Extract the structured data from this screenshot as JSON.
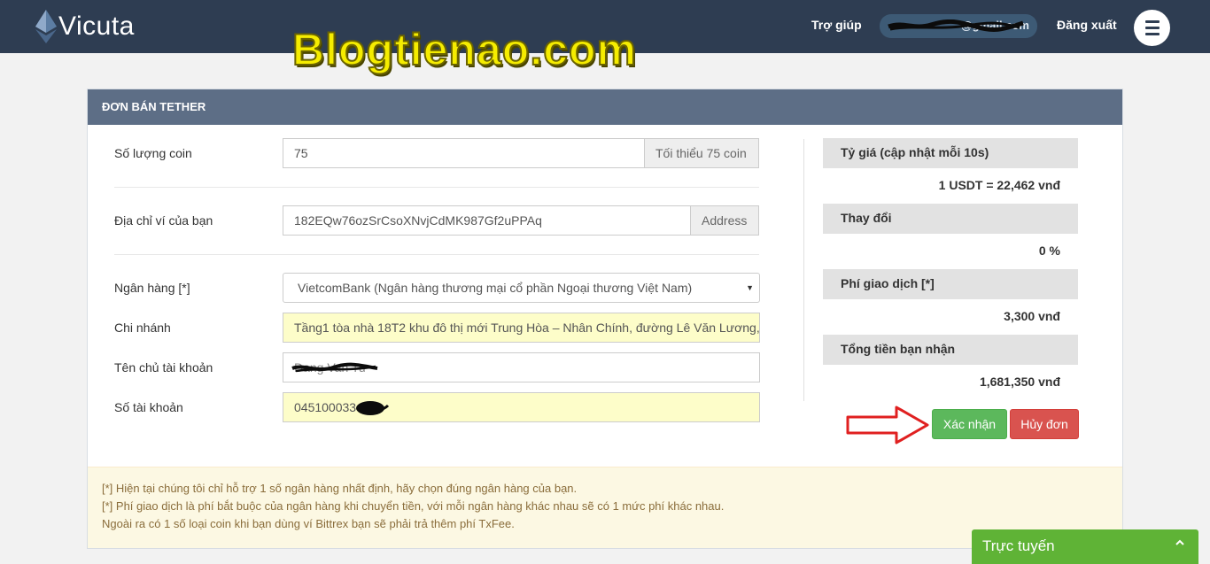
{
  "brand": {
    "name": "Vicuta"
  },
  "watermark": "Blogtienao.com",
  "nav": {
    "help": "Trợ giúp",
    "email": "@gmail.com",
    "logout": "Đăng xuất",
    "menu_icon": "hamburger-icon"
  },
  "panel": {
    "title": "ĐƠN BÁN TETHER",
    "coin_amount": {
      "label": "Số lượng coin",
      "value": "75",
      "addon": "Tối thiểu 75 coin"
    },
    "wallet": {
      "label": "Địa chỉ ví của bạn",
      "value": "182EQw76ozSrCsoXNvjCdMK987Gf2uPPAq",
      "addon": "Address"
    },
    "bank": {
      "label": "Ngân hàng [*]",
      "value": "VietcomBank (Ngân hàng thương mại cổ phần Ngoại thương Việt Nam)"
    },
    "branch": {
      "label": "Chi nhánh",
      "value": "Tầng1 tòa nhà 18T2 khu đô thị mới Trung Hòa – Nhân Chính, đường Lê Văn Lương,"
    },
    "holder": {
      "label": "Tên chủ tài khoản",
      "value": "Dang Van Tu"
    },
    "account_no": {
      "label": "Số tài khoản",
      "value": "045100033"
    }
  },
  "summary": {
    "rate_label": "Tỷ giá (cập nhật mỗi 10s)",
    "rate_value": "1 USDT = 22,462 vnđ",
    "change_label": "Thay đổi",
    "change_value": "0 %",
    "fee_label": "Phí giao dịch [*]",
    "fee_value": "3,300 vnđ",
    "total_label": "Tổng tiền bạn nhận",
    "total_value": "1,681,350 vnđ"
  },
  "buttons": {
    "confirm": "Xác nhận",
    "cancel": "Hủy đơn"
  },
  "notes": [
    "[*] Hiện tại chúng tôi chỉ hỗ trợ 1 số ngân hàng nhất định, hãy chọn đúng ngân hàng của bạn.",
    "[*] Phí giao dịch là phí bắt buộc của ngân hàng khi chuyển tiền, với mỗi ngân hàng khác nhau sẽ có 1 mức phí khác nhau.",
    "Ngoài ra có 1 số loại coin khi bạn dùng ví Bittrex bạn sẽ phải trả thêm phí TxFee."
  ],
  "chat": {
    "label": "Trực tuyến",
    "icon": "chevron-up-icon"
  },
  "colors": {
    "topbar": "#2e3d52",
    "panel_header": "#5d6e86",
    "confirm": "#5cb85c",
    "cancel": "#d9534f",
    "chat": "#5fb336",
    "watermark": "#f5ec00"
  }
}
